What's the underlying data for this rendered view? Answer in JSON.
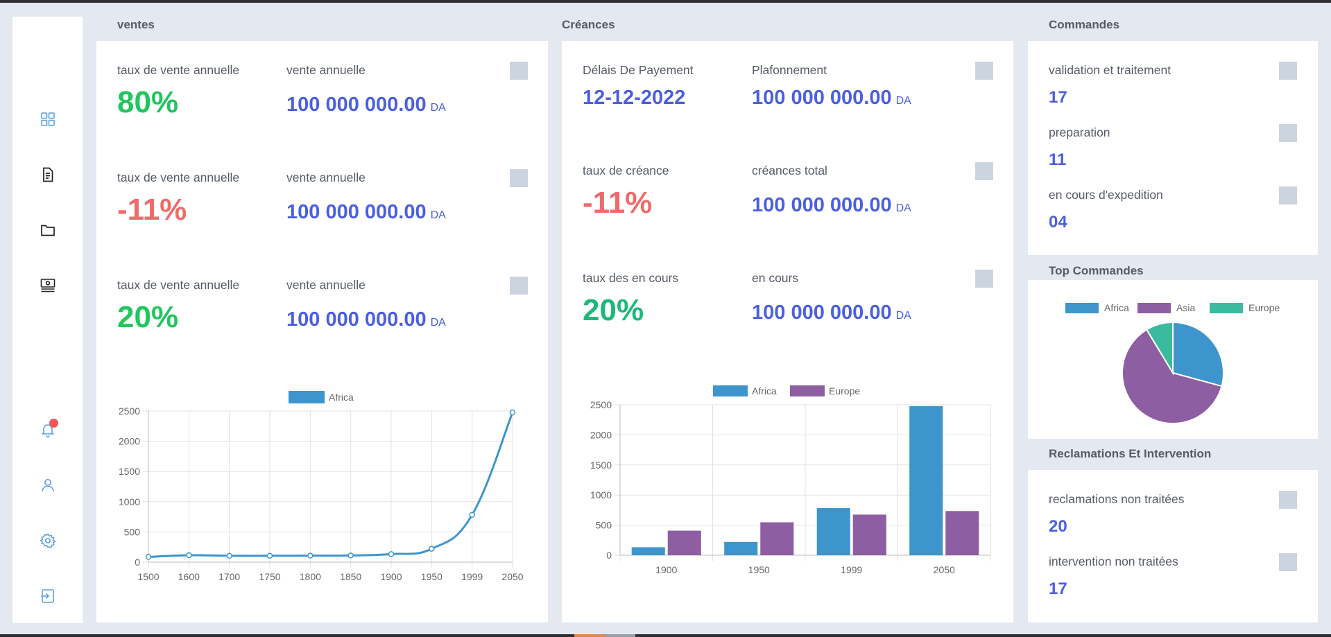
{
  "sidebar": {
    "icons": [
      "dashboard-icon",
      "document-icon",
      "folder-icon",
      "cash-register-icon",
      "bell-icon",
      "user-icon",
      "gear-icon",
      "logout-icon"
    ]
  },
  "ventes": {
    "title": "ventes",
    "rows": [
      {
        "rate_label": "taux de vente annuelle",
        "rate": "80%",
        "trend": "positive",
        "amount_label": "vente annuelle",
        "amount": "100 000 000.00",
        "currency": "DA"
      },
      {
        "rate_label": "taux de vente annuelle",
        "rate": "-11%",
        "trend": "negative",
        "amount_label": "vente annuelle",
        "amount": "100 000 000.00",
        "currency": "DA"
      },
      {
        "rate_label": "taux de vente annuelle",
        "rate": "20%",
        "trend": "positive",
        "amount_label": "vente annuelle",
        "amount": "100 000 000.00",
        "currency": "DA"
      }
    ]
  },
  "creances": {
    "title": "Créances",
    "row1": {
      "label_a": "Délais De Payement",
      "value_a": "12-12-2022",
      "label_b": "Plafonnement",
      "amount": "100 000 000.00",
      "currency": "DA"
    },
    "row2": {
      "label_a": "taux de créance",
      "value_a": "-11%",
      "label_b": "créances total",
      "amount": "100 000 000.00",
      "currency": "DA"
    },
    "row3": {
      "label_a": "taux des en cours",
      "value_a": "20%",
      "label_b": "en cours",
      "amount": "100 000 000.00",
      "currency": "DA"
    }
  },
  "commandes": {
    "title": "Commandes",
    "items": [
      {
        "label": "validation et traitement",
        "value": "17"
      },
      {
        "label": "preparation",
        "value": "11"
      },
      {
        "label": "en cours d'expedition",
        "value": "04"
      }
    ]
  },
  "top_commandes": {
    "title": "Top Commandes"
  },
  "reclamations": {
    "title": "Reclamations Et Intervention",
    "items": [
      {
        "label": "reclamations non traitées",
        "value": "20"
      },
      {
        "label": "intervention non traitées",
        "value": "17"
      }
    ]
  },
  "chart_data": [
    {
      "type": "line",
      "x": [
        "1500",
        "1600",
        "1700",
        "1750",
        "1800",
        "1850",
        "1900",
        "1950",
        "1999",
        "2050"
      ],
      "series": [
        {
          "name": "Africa",
          "values": [
            86,
            114,
            106,
            106,
            107,
            111,
            133,
            221,
            783,
            2478
          ],
          "color": "#3e95cd"
        }
      ],
      "ylim": [
        0,
        2500
      ],
      "yticks": [
        "0",
        "500",
        "1000",
        "1500",
        "2000",
        "2500"
      ],
      "legend": "top",
      "grid": true
    },
    {
      "type": "bar",
      "categories": [
        "1900",
        "1950",
        "1999",
        "2050"
      ],
      "series": [
        {
          "name": "Africa",
          "values": [
            133,
            221,
            783,
            2478
          ],
          "color": "#3e95cd"
        },
        {
          "name": "Europe",
          "values": [
            408,
            547,
            675,
            734
          ],
          "color": "#8e5ea2"
        }
      ],
      "ylim": [
        0,
        2500
      ],
      "yticks": [
        "0",
        "500",
        "1000",
        "1500",
        "2000",
        "2500"
      ],
      "legend": "top",
      "grid": true
    },
    {
      "type": "pie",
      "categories": [
        "Africa",
        "Asia",
        "Europe"
      ],
      "values": [
        2478,
        5267,
        734
      ],
      "colors": [
        "#3e95cd",
        "#8e5ea2",
        "#3cba9f"
      ],
      "legend": "top"
    }
  ]
}
